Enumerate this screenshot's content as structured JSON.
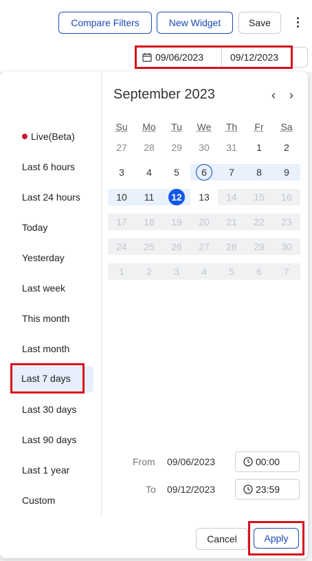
{
  "toolbar": {
    "compare_filters": "Compare Filters",
    "new_widget": "New Widget",
    "save": "Save"
  },
  "date_range": {
    "from": "09/06/2023",
    "to": "09/12/2023"
  },
  "presets": [
    {
      "label": "Live(Beta)"
    },
    {
      "label": "Last 6 hours"
    },
    {
      "label": "Last 24 hours"
    },
    {
      "label": "Today"
    },
    {
      "label": "Yesterday"
    },
    {
      "label": "Last week"
    },
    {
      "label": "This month"
    },
    {
      "label": "Last month"
    },
    {
      "label": "Last 7 days"
    },
    {
      "label": "Last 30 days"
    },
    {
      "label": "Last 90 days"
    },
    {
      "label": "Last 1 year"
    },
    {
      "label": "Custom"
    }
  ],
  "calendar": {
    "month_label": "September 2023",
    "prev_icon": "chevron-left-icon",
    "next_icon": "chevron-right-icon",
    "weekdays": [
      "Su",
      "Mo",
      "Tu",
      "We",
      "Th",
      "Fr",
      "Sa"
    ],
    "weeks": [
      [
        "27",
        "28",
        "29",
        "30",
        "31",
        "1",
        "2"
      ],
      [
        "3",
        "4",
        "5",
        "6",
        "7",
        "8",
        "9"
      ],
      [
        "10",
        "11",
        "12",
        "13",
        "14",
        "15",
        "16"
      ],
      [
        "17",
        "18",
        "19",
        "20",
        "21",
        "22",
        "23"
      ],
      [
        "24",
        "25",
        "26",
        "27",
        "28",
        "29",
        "30"
      ],
      [
        "1",
        "2",
        "3",
        "4",
        "5",
        "6",
        "7"
      ]
    ]
  },
  "time": {
    "from_label": "From",
    "from_date": "09/06/2023",
    "from_time": "00:00",
    "to_label": "To",
    "to_date": "09/12/2023",
    "to_time": "23:59"
  },
  "footer": {
    "cancel": "Cancel",
    "apply": "Apply"
  },
  "colors": {
    "accent": "#1157e6",
    "highlight_box": "#d90f1c",
    "range_bg": "#e8f1fc"
  }
}
